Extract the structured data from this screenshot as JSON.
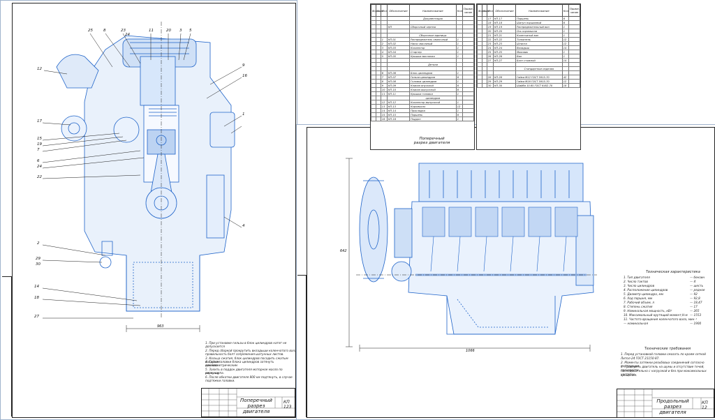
{
  "left_sheet": {
    "title": "Поперечный разрез двигателя",
    "code": "КП 123",
    "width_dimension": "963",
    "callouts": [
      "12",
      "25",
      "8",
      "23",
      "24",
      "11",
      "20",
      "3",
      "5",
      "9",
      "16",
      "1",
      "17",
      "15",
      "19",
      "7",
      "6",
      "24",
      "22",
      "2",
      "29",
      "30",
      "14",
      "18",
      "27",
      "4"
    ],
    "notes": [
      "1. При установке гильзы в блок цилиндров натяг не",
      "   допускается",
      "2. Перед сборкой прокрутить вкладыши коленчатого вала",
      "   правильность болт сопряжения шатунных листов.",
      "3. Кольца сжатия, блок цилиндров посадить сжатым воздухом.",
      "4. Гайки головки блока цилиндров затянуть динамометрическим",
      "   ключом.",
      "5. Залить в поддон двигателя моторное масло по верхнюю",
      "   риску щупа.",
      "6. После обкатки двигателя 800 км подтянуть, в случае",
      "   подтяжки головки."
    ]
  },
  "right_sheet": {
    "title": "Продольный разрез двигателя",
    "code": "КП 12",
    "height_dimension": "642",
    "width_dimension": "1066",
    "tech_spec_title": "Техническая характеристика",
    "tech_spec": [
      [
        "1. Тип двигателя",
        "— бензин"
      ],
      [
        "2. Число тактов",
        "— 4"
      ],
      [
        "3. Число цилиндров",
        "— шесть"
      ],
      [
        "4. Расположение цилиндров",
        "— рядное"
      ],
      [
        "5. Диаметр цилиндра, мм",
        "— 92"
      ],
      [
        "6. Ход поршня, мм",
        "— 92,8"
      ],
      [
        "7. Рабочий объем, л",
        "— 18,47"
      ],
      [
        "8. Степень сжатия",
        "— 17"
      ],
      [
        "9. Номинальная мощность, кВт",
        "— 265"
      ],
      [
        "10. Максимальный крутящий момент,Н·м",
        "— 1553"
      ],
      [
        "11. Частота вращения коленчатого вала, мин⁻¹",
        ""
      ],
      [
        "   — номинальная",
        "— 1900"
      ]
    ],
    "req_title": "Технические требования",
    "requirements": [
      "1. Перед установкой головки смазать по краям сеткой",
      "   Литол-24 ГОСТ 21150-87.",
      "2. Моменты затяжки резьбовых соединений согласно инструкции.",
      "3. Проверить двигатель на шумы и отсутствие течей, произвести",
      "   последовательно с нагрузкой и без при максимальных частотах",
      "   вращения."
    ]
  },
  "spec_sheet_1": {
    "title": "Поперечный разрез двигателя",
    "headers": [
      "Форм.",
      "Зона",
      "Поз.",
      "Обозначение",
      "Наименование",
      "Кол.",
      "Приме-чание"
    ],
    "rows": [
      [
        "",
        "",
        "",
        "",
        "Документация",
        "",
        ""
      ],
      [
        "",
        "",
        "",
        "",
        "",
        "",
        ""
      ],
      [
        "",
        "",
        "",
        "КП",
        "Сборочный чертеж",
        "",
        ""
      ],
      [
        "",
        "",
        "",
        "",
        "",
        "",
        ""
      ],
      [
        "",
        "",
        "",
        "",
        "Сборочные единицы",
        "",
        ""
      ],
      [
        "",
        "",
        "1",
        "КП-01",
        "Распределитель смазочный",
        "1",
        ""
      ],
      [
        "",
        "",
        "2",
        "КП-02",
        "Насос масляный",
        "1",
        ""
      ],
      [
        "",
        "",
        "3",
        "КП-03",
        "Коллектор",
        "1",
        ""
      ],
      [
        "",
        "",
        "4",
        "КП-04",
        "Стартер",
        "1",
        ""
      ],
      [
        "",
        "",
        "5",
        "КП-05",
        "Крышка масляная",
        "1",
        ""
      ],
      [
        "",
        "",
        "",
        "",
        "",
        "",
        ""
      ],
      [
        "",
        "",
        "",
        "",
        "Детали",
        "",
        ""
      ],
      [
        "",
        "",
        "",
        "",
        "",
        "",
        ""
      ],
      [
        "",
        "",
        "6",
        "КП-06",
        "Блок цилиндров",
        "1",
        ""
      ],
      [
        "",
        "",
        "7",
        "КП-07",
        "Гильза цилиндров",
        "6",
        ""
      ],
      [
        "",
        "",
        "8",
        "КП-08",
        "Головка цилиндров",
        "1",
        ""
      ],
      [
        "",
        "",
        "9",
        "КП-09",
        "Клапан впускной",
        "6",
        ""
      ],
      [
        "",
        "",
        "10",
        "КП-10",
        "Клапан выпускной",
        "6",
        ""
      ],
      [
        "",
        "",
        "11",
        "КП-11",
        "Крышка головки",
        "1",
        ""
      ],
      [
        "",
        "",
        "",
        "",
        "цилиндров",
        "",
        ""
      ],
      [
        "",
        "",
        "12",
        "КП-12",
        "Коллектор выпускной",
        "1",
        ""
      ],
      [
        "",
        "",
        "13",
        "КП-13",
        "Коромысло",
        "12",
        ""
      ],
      [
        "",
        "",
        "14",
        "КП-14",
        "Прокладка",
        "1",
        ""
      ],
      [
        "",
        "",
        "15",
        "КП-15",
        "Поршень",
        "6",
        ""
      ],
      [
        "",
        "",
        "16",
        "КП-16",
        "Поддон",
        "1",
        ""
      ]
    ]
  },
  "spec_sheet_2": {
    "headers": [
      "Форм.",
      "Зона",
      "Поз.",
      "Обозначение",
      "Наименование",
      "Кол.",
      "Приме-чание"
    ],
    "rows": [
      [
        "",
        "",
        "17",
        "КП-17",
        "Поршень",
        "6",
        ""
      ],
      [
        "",
        "",
        "18",
        "КП-18",
        "Шатун поршневой",
        "6",
        ""
      ],
      [
        "",
        "",
        "19",
        "КП-19",
        "Распределительный вал",
        "1",
        ""
      ],
      [
        "",
        "",
        "20",
        "КП-20",
        "Ось коромысла",
        "1",
        ""
      ],
      [
        "",
        "",
        "21",
        "КП-21",
        "Коленчатый вал",
        "1",
        ""
      ],
      [
        "",
        "",
        "22",
        "КП-22",
        "Толкатель",
        "12",
        ""
      ],
      [
        "",
        "",
        "23",
        "КП-23",
        "Штанга",
        "12",
        ""
      ],
      [
        "",
        "",
        "24",
        "КП-24",
        "Вкладыш",
        "14",
        ""
      ],
      [
        "",
        "",
        "25",
        "КП-25",
        "Маховик",
        "1",
        ""
      ],
      [
        "",
        "",
        "26",
        "КП-26",
        "Вал",
        "1",
        ""
      ],
      [
        "",
        "",
        "27",
        "КП-27",
        "Болт стяжной",
        "14",
        ""
      ],
      [
        "",
        "",
        "",
        "",
        "",
        "",
        ""
      ],
      [
        "",
        "",
        "",
        "",
        "Стандартные изделия",
        "",
        ""
      ],
      [
        "",
        "",
        "",
        "",
        "",
        "",
        ""
      ],
      [
        "",
        "",
        "28",
        "КП-28",
        "Гайка М12 ГОСТ 5915-70",
        "42",
        ""
      ],
      [
        "",
        "",
        "29",
        "КП-29",
        "Гайка М16 ГОСТ 5915-70",
        "12",
        ""
      ],
      [
        "",
        "",
        "30",
        "КП-30",
        "Шайба 10.65 ГОСТ 6402-70",
        "18",
        ""
      ]
    ]
  }
}
